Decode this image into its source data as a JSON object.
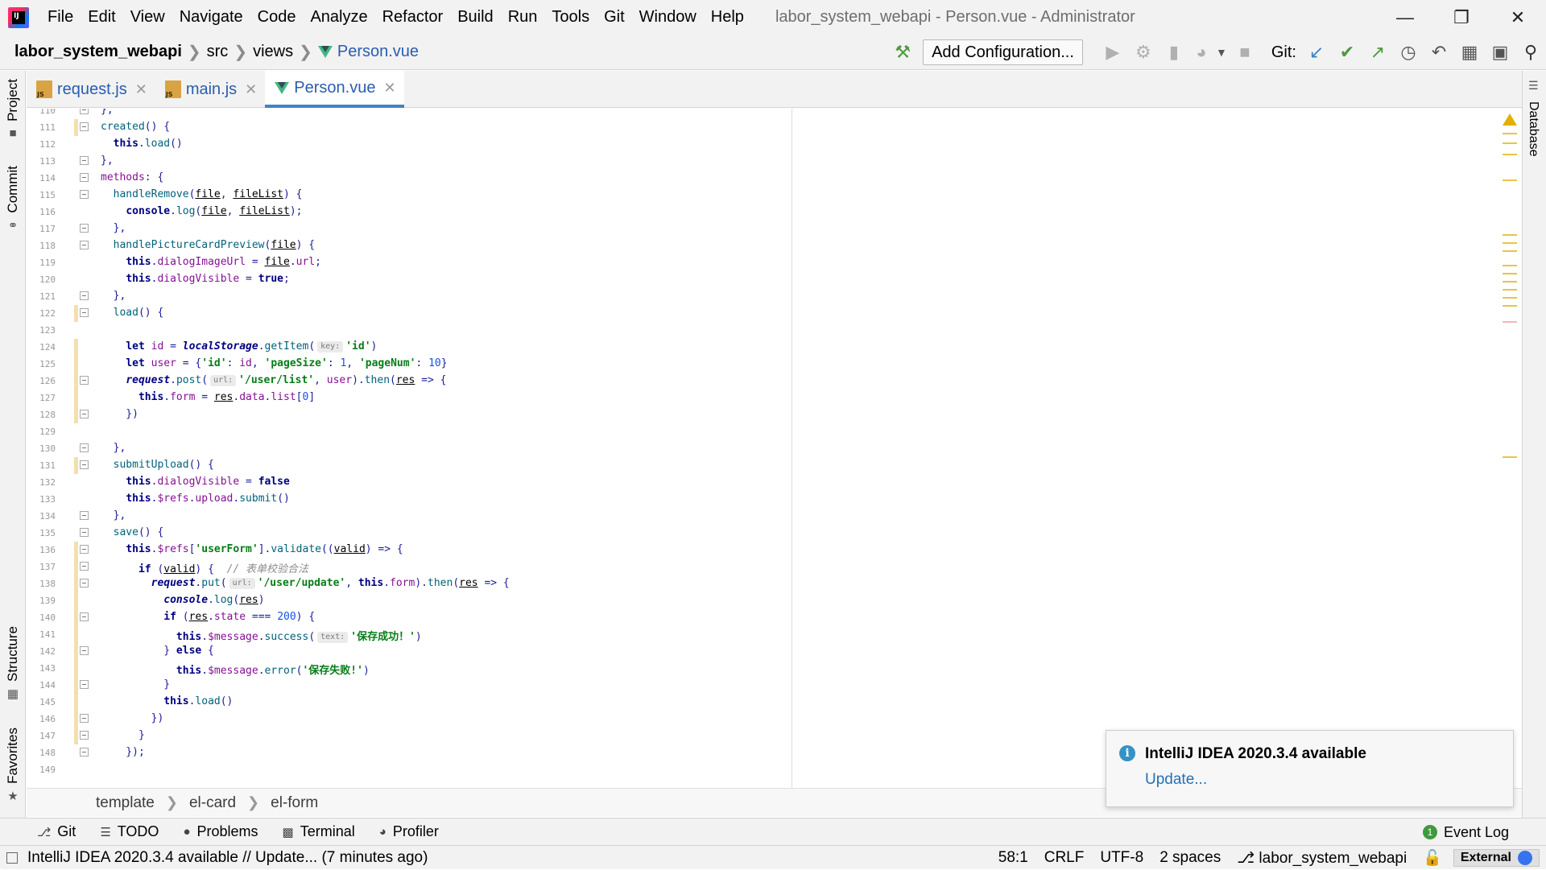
{
  "menu": [
    "File",
    "Edit",
    "View",
    "Navigate",
    "Code",
    "Analyze",
    "Refactor",
    "Build",
    "Run",
    "Tools",
    "Git",
    "Window",
    "Help"
  ],
  "window_title": "labor_system_webapi - Person.vue - Administrator",
  "nav": {
    "project": "labor_system_webapi",
    "path1": "src",
    "path2": "views",
    "file": "Person.vue",
    "config_button": "Add Configuration...",
    "git_label": "Git:"
  },
  "left_tabs": {
    "project": "Project",
    "commit": "Commit",
    "structure": "Structure",
    "favorites": "Favorites"
  },
  "right_tab": "Database",
  "tabs": [
    {
      "label": "request.js"
    },
    {
      "label": "main.js"
    },
    {
      "label": "Person.vue"
    }
  ],
  "breadcrumb": [
    "template",
    "el-card",
    "el-form"
  ],
  "toolwindows": [
    "Git",
    "TODO",
    "Problems",
    "Terminal",
    "Profiler"
  ],
  "event_log": "Event Log",
  "status": {
    "message": "IntelliJ IDEA 2020.3.4 available // Update... (7 minutes ago)",
    "position": "58:1",
    "line_sep": "CRLF",
    "encoding": "UTF-8",
    "indent": "2 spaces",
    "branch": "labor_system_webapi",
    "external": "External"
  },
  "notification": {
    "title": "IntelliJ IDEA 2020.3.4 available",
    "link": "Update..."
  }
}
